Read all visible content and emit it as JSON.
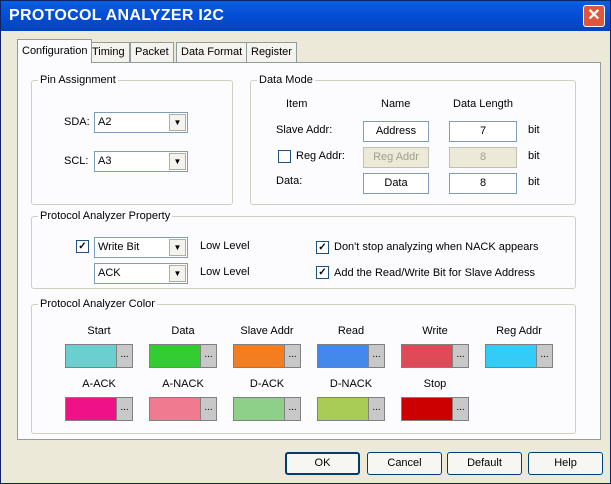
{
  "window": {
    "title": "PROTOCOL ANALYZER I2C",
    "close_glyph": "✕"
  },
  "tabs": [
    "Configuration",
    "Timing",
    "Packet",
    "Data Format",
    "Register"
  ],
  "pin_assignment": {
    "title": "Pin Assignment",
    "sda_label": "SDA:",
    "sda_value": "A2",
    "scl_label": "SCL:",
    "scl_value": "A3"
  },
  "data_mode": {
    "title": "Data Mode",
    "col_item": "Item",
    "col_name": "Name",
    "col_length": "Data Length",
    "slave_label": "Slave Addr:",
    "slave_name": "Address",
    "slave_length": "7",
    "reg_label": "Reg Addr:",
    "reg_name": "Reg Addr",
    "reg_length": "8",
    "reg_checked": false,
    "data_label": "Data:",
    "data_name": "Data",
    "data_length": "8",
    "unit": "bit"
  },
  "property": {
    "title": "Protocol Analyzer Property",
    "rw_checked": true,
    "rw_value": "Write Bit",
    "rw_level": "Low Level",
    "ack_value": "ACK",
    "ack_level": "Low Level",
    "nack_text": "Don't stop analyzing  when NACK appears",
    "nack_checked": true,
    "addrw_text": "Add the Read/Write Bit for Slave Address",
    "addrw_checked": true
  },
  "colors": {
    "title": "Protocol Analyzer Color",
    "more_glyph": "...",
    "items": [
      {
        "label": "Start",
        "color": "#6ccfcf"
      },
      {
        "label": "Data",
        "color": "#33cc33"
      },
      {
        "label": "Slave Addr",
        "color": "#f47d20"
      },
      {
        "label": "Read",
        "color": "#4488ee"
      },
      {
        "label": "Write",
        "color": "#e04a58"
      },
      {
        "label": "Reg Addr",
        "color": "#33ccf6"
      },
      {
        "label": "A-ACK",
        "color": "#ee1188"
      },
      {
        "label": "A-NACK",
        "color": "#f07b90"
      },
      {
        "label": "D-ACK",
        "color": "#8ecf8a"
      },
      {
        "label": "D-NACK",
        "color": "#a8cc55"
      },
      {
        "label": "Stop",
        "color": "#cc0000"
      }
    ]
  },
  "buttons": {
    "ok": "OK",
    "cancel": "Cancel",
    "default": "Default",
    "help": "Help"
  },
  "check_glyph": "✓",
  "arrow_glyph": "▼"
}
